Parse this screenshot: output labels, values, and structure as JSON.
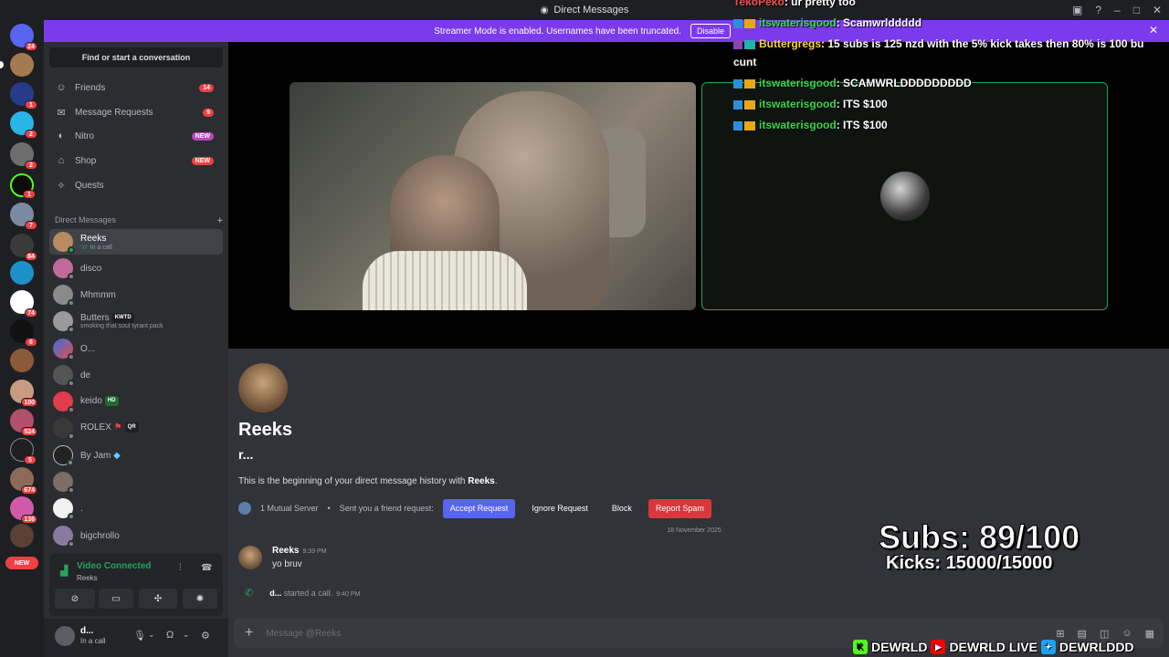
{
  "window": {
    "title": "Direct Messages"
  },
  "banner": {
    "text": "Streamer Mode is enabled. Usernames have been truncated.",
    "disable_label": "Disable"
  },
  "rail_badges": [
    "24",
    "1",
    "2",
    "2",
    "1",
    "7",
    "84",
    "74",
    "6",
    "100",
    "524",
    "5",
    "674",
    "136"
  ],
  "rail_new": "NEW",
  "sidebar": {
    "search_label": "Find or start a conversation",
    "nav": [
      {
        "label": "Friends",
        "icon": "friends-icon",
        "count": "14"
      },
      {
        "label": "Message Requests",
        "icon": "mail-icon",
        "count": "9"
      },
      {
        "label": "Nitro",
        "icon": "nitro-icon",
        "badge": "NEW"
      },
      {
        "label": "Shop",
        "icon": "shop-icon",
        "badge": "NEW"
      },
      {
        "label": "Quests",
        "icon": "quests-icon"
      }
    ],
    "dm_header": "Direct Messages",
    "dms": [
      {
        "name": "Reeks",
        "sub": "In a call"
      },
      {
        "name": "disco",
        "sub": ""
      },
      {
        "name": "Mhmmm",
        "sub": ""
      },
      {
        "name": "Butters",
        "tag": "KWTD",
        "sub": "smoking that soul tyrant pack"
      },
      {
        "name": "O...",
        "sub": ""
      },
      {
        "name": "de",
        "sub": ""
      },
      {
        "name": "keido",
        "tag": "HD",
        "sub": ""
      },
      {
        "name": "ROLEX",
        "tag": "QR",
        "sub": ""
      },
      {
        "name": "By Jam",
        "sub": ""
      },
      {
        "name": "",
        "sub": ""
      },
      {
        "name": ".",
        "sub": ""
      },
      {
        "name": "bigchrollo",
        "sub": ""
      }
    ]
  },
  "voice": {
    "status": "Video Connected",
    "channel": "Reeks"
  },
  "user": {
    "name": "d...",
    "status": "In a call"
  },
  "chat_overlay": [
    {
      "user": "TekoPeko",
      "msg": ": ur pretty too"
    },
    {
      "user": "itswaterisgood",
      "msg": ": Scamwrlddddd"
    },
    {
      "user": "Buttergregs",
      "msg": ": 15 subs is 125 nzd with the 5% kick takes then 80% is 100 bu"
    },
    {
      "user": "",
      "msg": "cunt"
    },
    {
      "user": "itswaterisgood",
      "msg": ": SCAMWRLDDDDDDDDD"
    },
    {
      "user": "itswaterisgood",
      "msg": ": ITS $100"
    },
    {
      "user": "itswaterisgood",
      "msg": ": ITS $100"
    }
  ],
  "profile": {
    "name": "Reeks",
    "handle": "r...",
    "desc_prefix": "This is the beginning of your direct message history with ",
    "desc_name": "Reeks",
    "desc_suffix": ".",
    "mutual": "1 Mutual Server",
    "friend_req": "Sent you a friend request:",
    "accept": "Accept Request",
    "ignore": "Ignore Request",
    "block": "Block",
    "spam": "Report Spam"
  },
  "date_sep": "18 November 2025",
  "message": {
    "author": "Reeks",
    "time": "9:39 PM",
    "text": "yo bruv"
  },
  "call_event": {
    "author": "d...",
    "text": "started a call.",
    "time": "9:40 PM"
  },
  "composer": {
    "placeholder": "Message @Reeks"
  },
  "overlay": {
    "subs": "Subs: 89/100",
    "kicks": "Kicks: 15000/15000",
    "socials": [
      "DEWRLD",
      "DEWRLD LIVE",
      "DEWRLDDD"
    ]
  }
}
